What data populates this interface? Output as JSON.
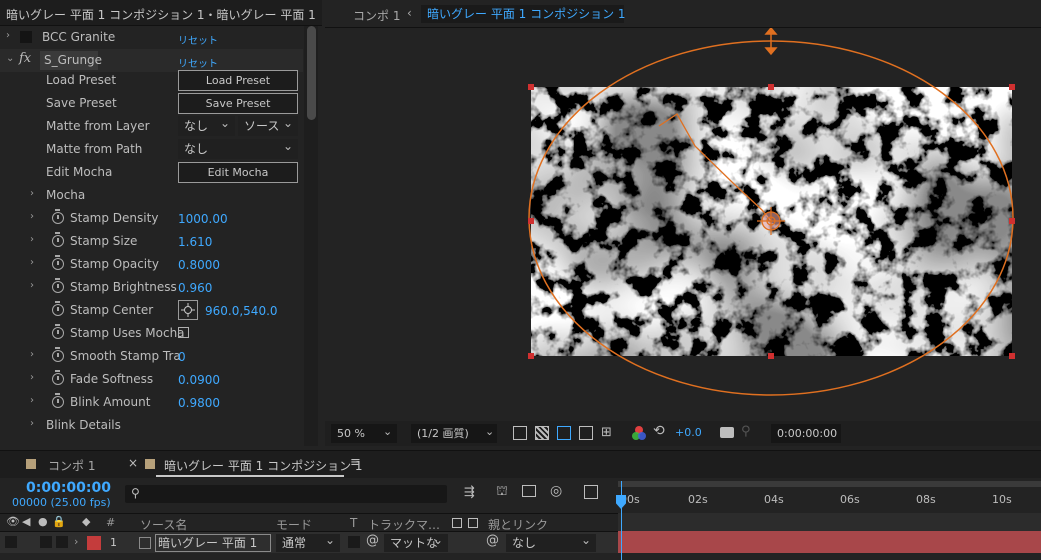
{
  "panel_title": "暗いグレー 平面 1 コンポジション 1・暗いグレー 平面 1",
  "effects": [
    {
      "name": "BCC Granite",
      "reset": "リセット"
    },
    {
      "name": "S_Grunge",
      "reset": "リセット",
      "fx_label": "fx"
    }
  ],
  "params": {
    "load_preset": {
      "label": "Load Preset",
      "button": "Load Preset"
    },
    "save_preset": {
      "label": "Save Preset",
      "button": "Save Preset"
    },
    "matte_from_layer": {
      "label": "Matte from Layer",
      "value1": "なし",
      "value2": "ソース"
    },
    "matte_from_path": {
      "label": "Matte from Path",
      "value": "なし"
    },
    "edit_mocha": {
      "label": "Edit Mocha",
      "button": "Edit Mocha"
    },
    "mocha": {
      "label": "Mocha"
    },
    "stamp_density": {
      "label": "Stamp Density",
      "value": "1000.00"
    },
    "stamp_size": {
      "label": "Stamp Size",
      "value": "1.610"
    },
    "stamp_opacity": {
      "label": "Stamp Opacity",
      "value": "0.8000"
    },
    "stamp_brightness": {
      "label": "Stamp Brightness",
      "value": "0.960"
    },
    "stamp_center": {
      "label": "Stamp Center",
      "value": "960.0,540.0"
    },
    "stamp_uses_mocha": {
      "label": "Stamp Uses Mocha"
    },
    "smooth_stamp": {
      "label": "Smooth Stamp Tra",
      "value": "0"
    },
    "fade_softness": {
      "label": "Fade Softness",
      "value": "0.0900"
    },
    "blink_amount": {
      "label": "Blink Amount",
      "value": "0.9800"
    },
    "blink_details": {
      "label": "Blink Details"
    }
  },
  "viewer": {
    "tab1": "コンポ 1",
    "tab2": "暗いグレー 平面 1 コンポジション 1",
    "zoom": "50 %",
    "resolution": "(1/2 画質)",
    "exposure": "+0.0",
    "timecode": "0:00:00:00"
  },
  "timeline": {
    "tab1": "コンポ 1",
    "tab2": "暗いグレー 平面 1 コンポジション 1",
    "timecode": "0:00:00:00",
    "frames": "00000 (25.00 fps)",
    "search_placeholder": "",
    "ruler": [
      "00s",
      "02s",
      "04s",
      "06s",
      "08s",
      "10s"
    ],
    "columns": {
      "num": "#",
      "source_name": "ソース名",
      "mode": "モード",
      "t": "T",
      "track_matte": "トラックマ…",
      "parent": "親とリンク"
    },
    "layer": {
      "number": "1",
      "name": "暗いグレー 平面 1",
      "mode": "通常",
      "matte": "マットな",
      "parent": "なし"
    }
  },
  "colors": {
    "accent_blue": "#3fa9ff",
    "orange": "#e07020",
    "layer_red": "#c43c3c",
    "track_red": "#a8474a"
  }
}
